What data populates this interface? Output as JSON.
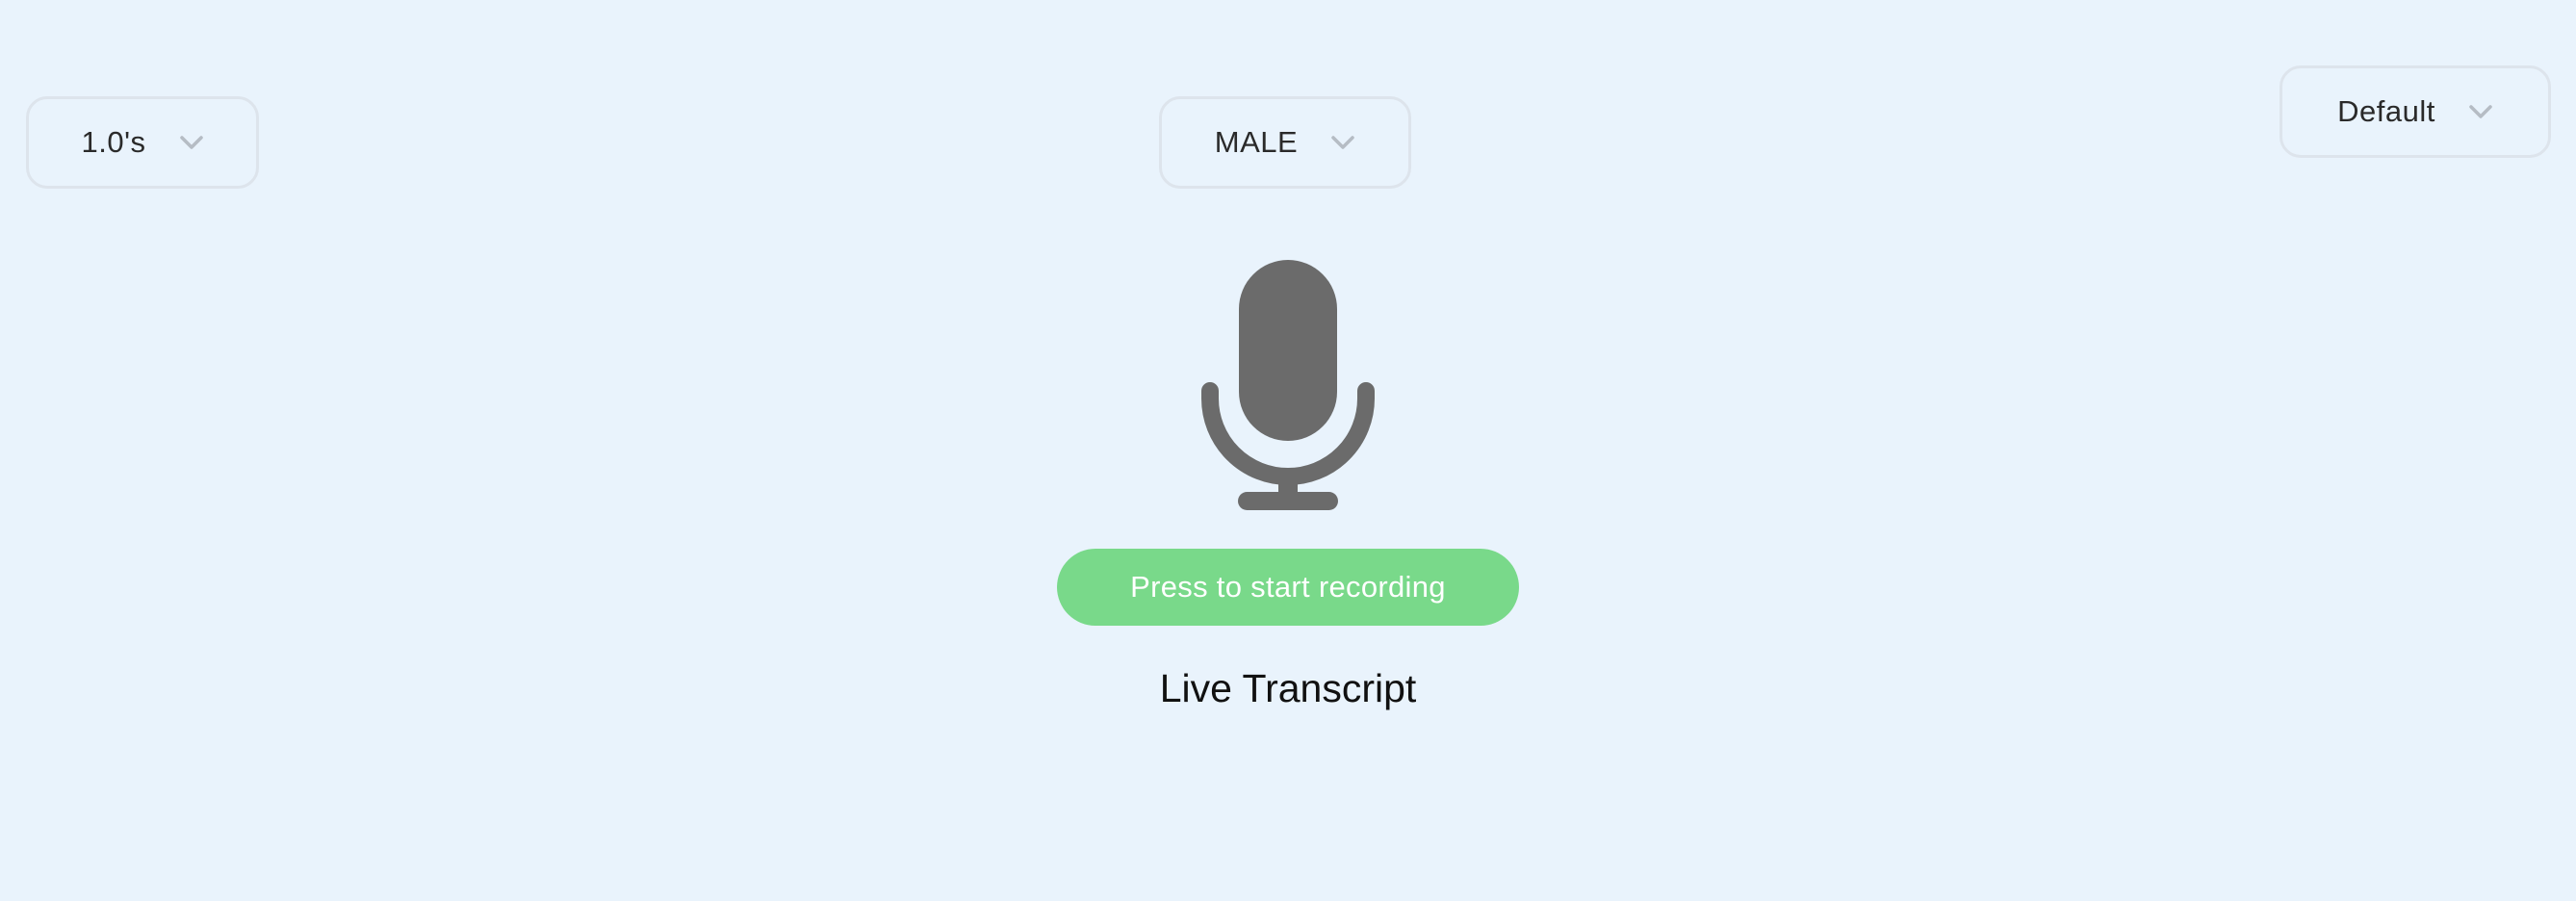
{
  "controls": {
    "interval_select": {
      "value": "1.0's"
    },
    "voice_select": {
      "value": "MALE"
    },
    "device_select": {
      "value": "Default"
    }
  },
  "recorder": {
    "icon": "microphone-icon",
    "button_label": "Press to start recording"
  },
  "transcript": {
    "title": "Live Transcript"
  },
  "colors": {
    "background": "#e9f3fc",
    "record_button": "#79d98a",
    "microphone": "#6b6b6b",
    "chevron": "#b5bcc4"
  }
}
